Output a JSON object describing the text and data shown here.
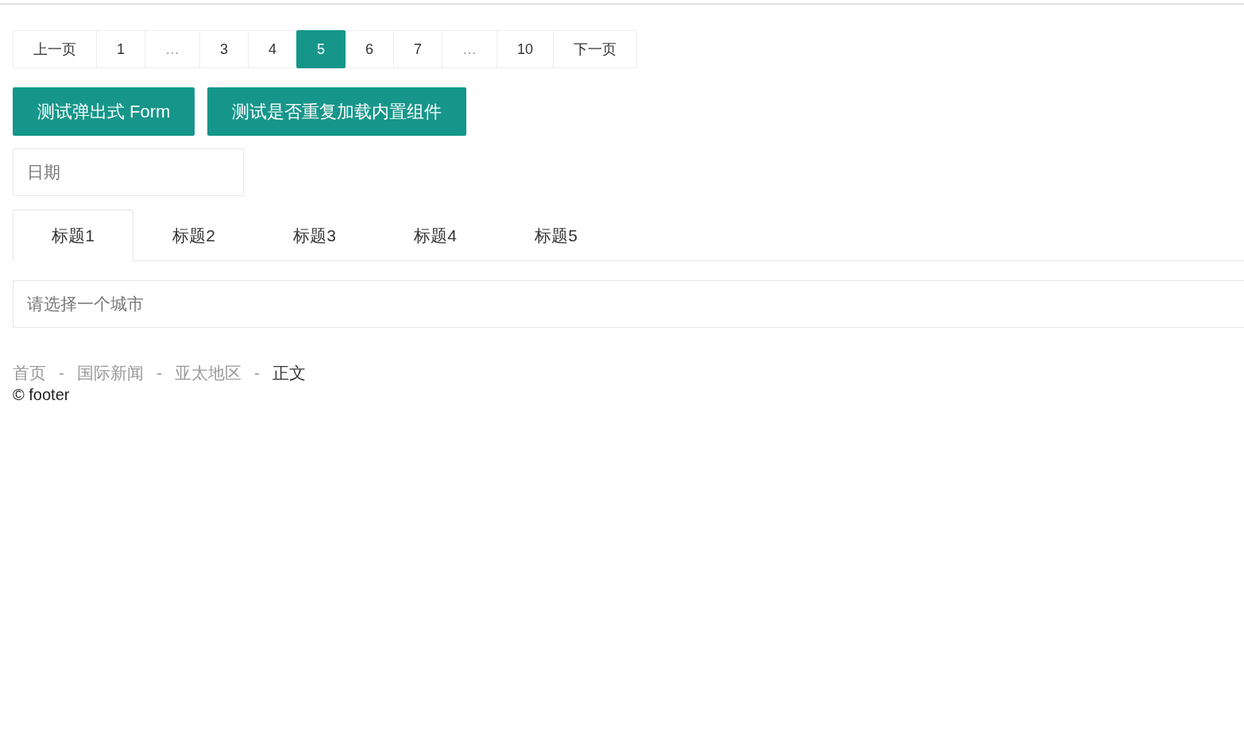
{
  "pagination": {
    "items": [
      {
        "kind": "prev",
        "label": "上一页",
        "selected": false
      },
      {
        "kind": "page",
        "label": "1",
        "selected": false
      },
      {
        "kind": "ellipsis",
        "label": "…",
        "selected": false
      },
      {
        "kind": "page",
        "label": "3",
        "selected": false
      },
      {
        "kind": "page",
        "label": "4",
        "selected": false
      },
      {
        "kind": "page",
        "label": "5",
        "selected": true
      },
      {
        "kind": "page",
        "label": "6",
        "selected": false
      },
      {
        "kind": "page",
        "label": "7",
        "selected": false
      },
      {
        "kind": "ellipsis",
        "label": "…",
        "selected": false
      },
      {
        "kind": "page",
        "label": "10",
        "selected": false
      },
      {
        "kind": "next",
        "label": "下一页",
        "selected": false
      }
    ]
  },
  "buttons": [
    {
      "label": "测试弹出式 Form"
    },
    {
      "label": "测试是否重复加载内置组件"
    }
  ],
  "date_field": {
    "placeholder": "日期"
  },
  "tabs": [
    {
      "label": "标题1",
      "selected": true
    },
    {
      "label": "标题2",
      "selected": false
    },
    {
      "label": "标题3",
      "selected": false
    },
    {
      "label": "标题4",
      "selected": false
    },
    {
      "label": "标题5",
      "selected": false
    }
  ],
  "city_field": {
    "placeholder": "请选择一个城市"
  },
  "breadcrumb": [
    {
      "kind": "link",
      "label": "首页"
    },
    {
      "kind": "separator",
      "label": "-"
    },
    {
      "kind": "link",
      "label": "国际新闻"
    },
    {
      "kind": "separator",
      "label": "-"
    },
    {
      "kind": "link",
      "label": "亚太地区"
    },
    {
      "kind": "separator",
      "label": "-"
    },
    {
      "kind": "current",
      "label": "正文"
    }
  ],
  "footer": {
    "text": "© footer"
  }
}
